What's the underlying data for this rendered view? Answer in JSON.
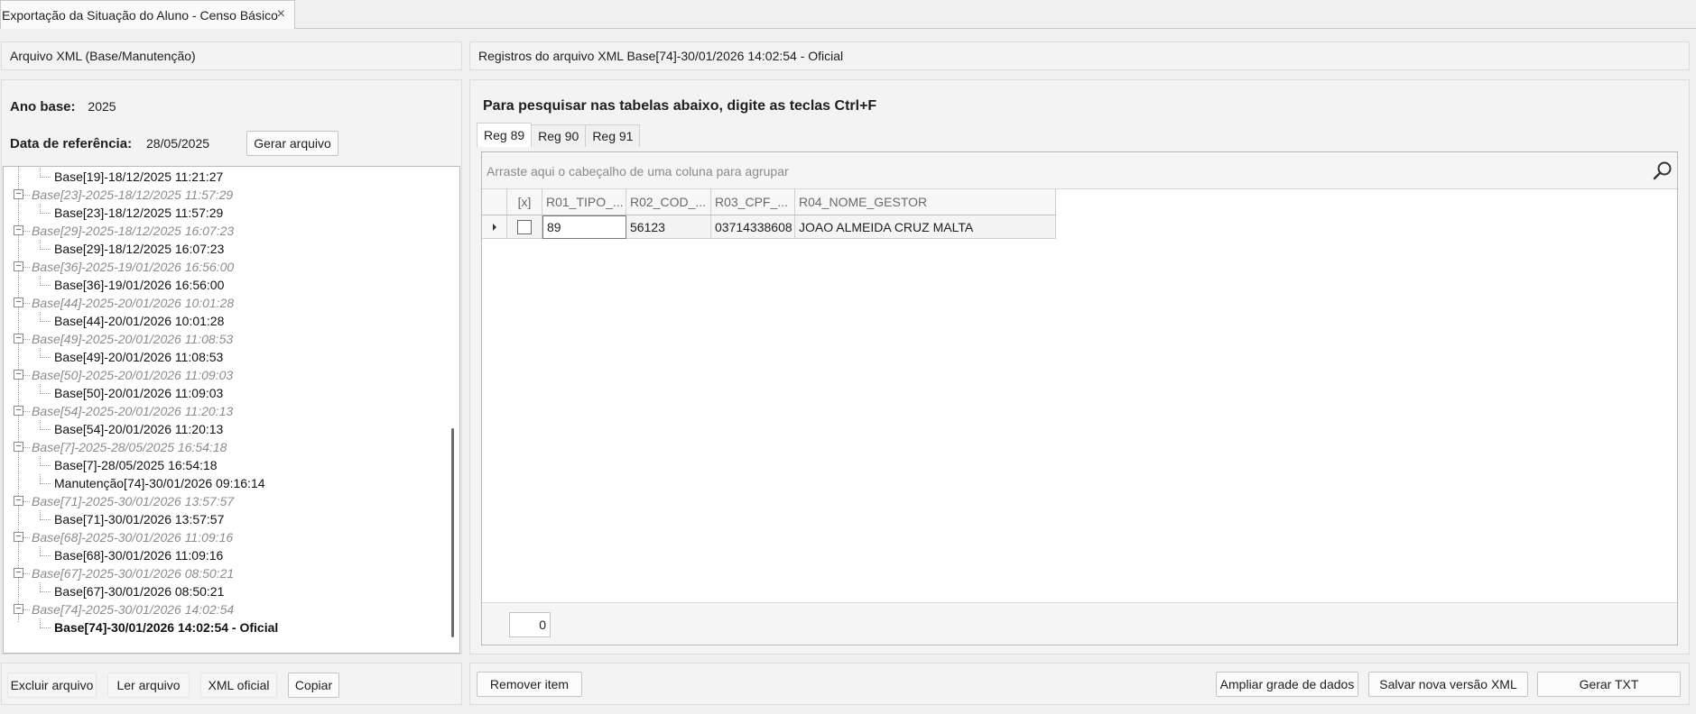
{
  "window_tab": {
    "title": "Exportação da Situação do Aluno - Censo Básico",
    "close_glyph": "×"
  },
  "left_header": "Arquivo XML (Base/Manutenção)",
  "right_header": "Registros do arquivo XML Base[74]-30/01/2026 14:02:54 - Oficial",
  "form": {
    "ano_base_label": "Ano base:",
    "ano_base_value": "2025",
    "data_ref_label": "Data de referência:",
    "data_ref_value": "28/05/2025",
    "gerar_button": "Gerar arquivo"
  },
  "tree": [
    {
      "type": "child",
      "text": "Base[19]-18/12/2025 11:21:27"
    },
    {
      "type": "parent",
      "text": "Base[23]-2025-18/12/2025 11:57:29"
    },
    {
      "type": "child",
      "text": "Base[23]-18/12/2025 11:57:29"
    },
    {
      "type": "parent",
      "text": "Base[29]-2025-18/12/2025 16:07:23"
    },
    {
      "type": "child",
      "text": "Base[29]-18/12/2025 16:07:23"
    },
    {
      "type": "parent",
      "text": "Base[36]-2025-19/01/2026 16:56:00"
    },
    {
      "type": "child",
      "text": "Base[36]-19/01/2026 16:56:00"
    },
    {
      "type": "parent",
      "text": "Base[44]-2025-20/01/2026 10:01:28"
    },
    {
      "type": "child",
      "text": "Base[44]-20/01/2026 10:01:28"
    },
    {
      "type": "parent",
      "text": "Base[49]-2025-20/01/2026 11:08:53"
    },
    {
      "type": "child",
      "text": "Base[49]-20/01/2026 11:08:53"
    },
    {
      "type": "parent",
      "text": "Base[50]-2025-20/01/2026 11:09:03"
    },
    {
      "type": "child",
      "text": "Base[50]-20/01/2026 11:09:03"
    },
    {
      "type": "parent",
      "text": "Base[54]-2025-20/01/2026 11:20:13"
    },
    {
      "type": "child",
      "text": "Base[54]-20/01/2026 11:20:13"
    },
    {
      "type": "parent",
      "text": "Base[7]-2025-28/05/2025 16:54:18"
    },
    {
      "type": "child",
      "text": "Base[7]-28/05/2025 16:54:18"
    },
    {
      "type": "child",
      "text": "Manutenção[74]-30/01/2026 09:16:14"
    },
    {
      "type": "parent",
      "text": "Base[71]-2025-30/01/2026 13:57:57"
    },
    {
      "type": "child",
      "text": "Base[71]-30/01/2026 13:57:57"
    },
    {
      "type": "parent",
      "text": "Base[68]-2025-30/01/2026 11:09:16"
    },
    {
      "type": "child",
      "text": "Base[68]-30/01/2026 11:09:16"
    },
    {
      "type": "parent",
      "text": "Base[67]-2025-30/01/2026 08:50:21"
    },
    {
      "type": "child",
      "text": "Base[67]-30/01/2026 08:50:21"
    },
    {
      "type": "parent",
      "text": "Base[74]-2025-30/01/2026 14:02:54"
    },
    {
      "type": "child",
      "text": "Base[74]-30/01/2026 14:02:54 - Oficial",
      "selected": true
    }
  ],
  "left_buttons": {
    "excluir": "Excluir arquivo",
    "ler": "Ler arquivo",
    "xml_oficial": "XML oficial",
    "copiar": "Copiar"
  },
  "hint": "Para pesquisar nas tabelas abaixo, digite as teclas Ctrl+F",
  "reg_tabs": [
    "Reg 89",
    "Reg 90",
    "Reg 91"
  ],
  "grid": {
    "group_placeholder": "Arraste aqui o cabeçalho de uma coluna para agrupar",
    "columns": [
      "[x]",
      "R01_TIPO_...",
      "R02_COD_...",
      "R03_CPF_...",
      "R04_NOME_GESTOR"
    ],
    "rows": [
      {
        "checked": false,
        "cells": [
          "89",
          "56123",
          "03714338608",
          "JOAO ALMEIDA CRUZ MALTA"
        ]
      }
    ],
    "footer_count": "0"
  },
  "right_buttons": {
    "remover": "Remover item",
    "ampliar": "Ampliar grade de dados",
    "salvar": "Salvar nova versão XML",
    "gerar_txt": "Gerar TXT"
  }
}
